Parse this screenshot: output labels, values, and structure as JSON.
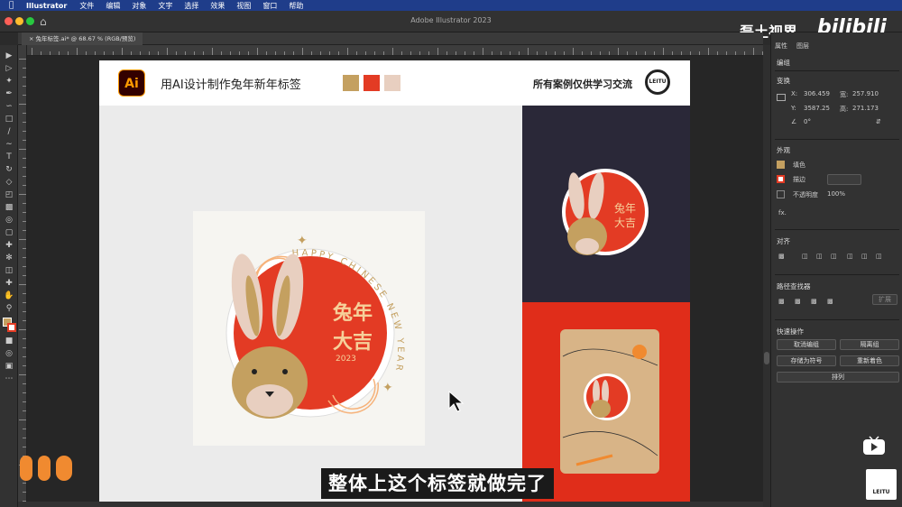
{
  "menubar": {
    "app": "Illustrator",
    "items": [
      "文件",
      "编辑",
      "对象",
      "文字",
      "选择",
      "效果",
      "视图",
      "窗口",
      "帮助"
    ]
  },
  "window": {
    "title": "Adobe Illustrator 2023",
    "doc_tab": "兔年标签.ai* @ 68.67 % (RGB/预览)"
  },
  "watermark": {
    "top": "磊土视界",
    "bili": "bilibili",
    "leitu": "LEITU"
  },
  "subtitle": "整体上这个标签就做完了",
  "artboard": {
    "logo": "Ai",
    "title": "用AI设计制作兔年新年标签",
    "right_text": "所有案例仅供学习交流",
    "seal": "LEITU",
    "swatches": [
      "#c4a060",
      "#e33b24",
      "#e8cfc0"
    ],
    "ring_text": "HAPPY CHINESE NEW YEAR",
    "year": "2023"
  },
  "panel": {
    "tabs": [
      "属性",
      "图层"
    ],
    "group": "编组",
    "transform": "变换",
    "x_label": "X:",
    "x": "306.459",
    "y_label": "Y:",
    "y": "3587.25",
    "w_label": "宽:",
    "w": "257.910",
    "h_label": "高:",
    "h": "271.173",
    "angle": "0°",
    "appearance": "外观",
    "fill": "填色",
    "stroke": "描边",
    "opacity_label": "不透明度",
    "opacity": "100%",
    "fx": "fx.",
    "align": "对齐",
    "pathfinder": "路径查找器",
    "expand": "扩展",
    "quick_actions": "快速操作",
    "btn_ungroup": "取消编组",
    "btn_isolate": "隔离组",
    "btn_save_symbol": "存储为符号",
    "btn_recolor": "重新着色",
    "btn_arrange": "排列"
  },
  "colors": {
    "accent": "#e33b24",
    "gold": "#c4a060",
    "dark": "#2a2838"
  }
}
